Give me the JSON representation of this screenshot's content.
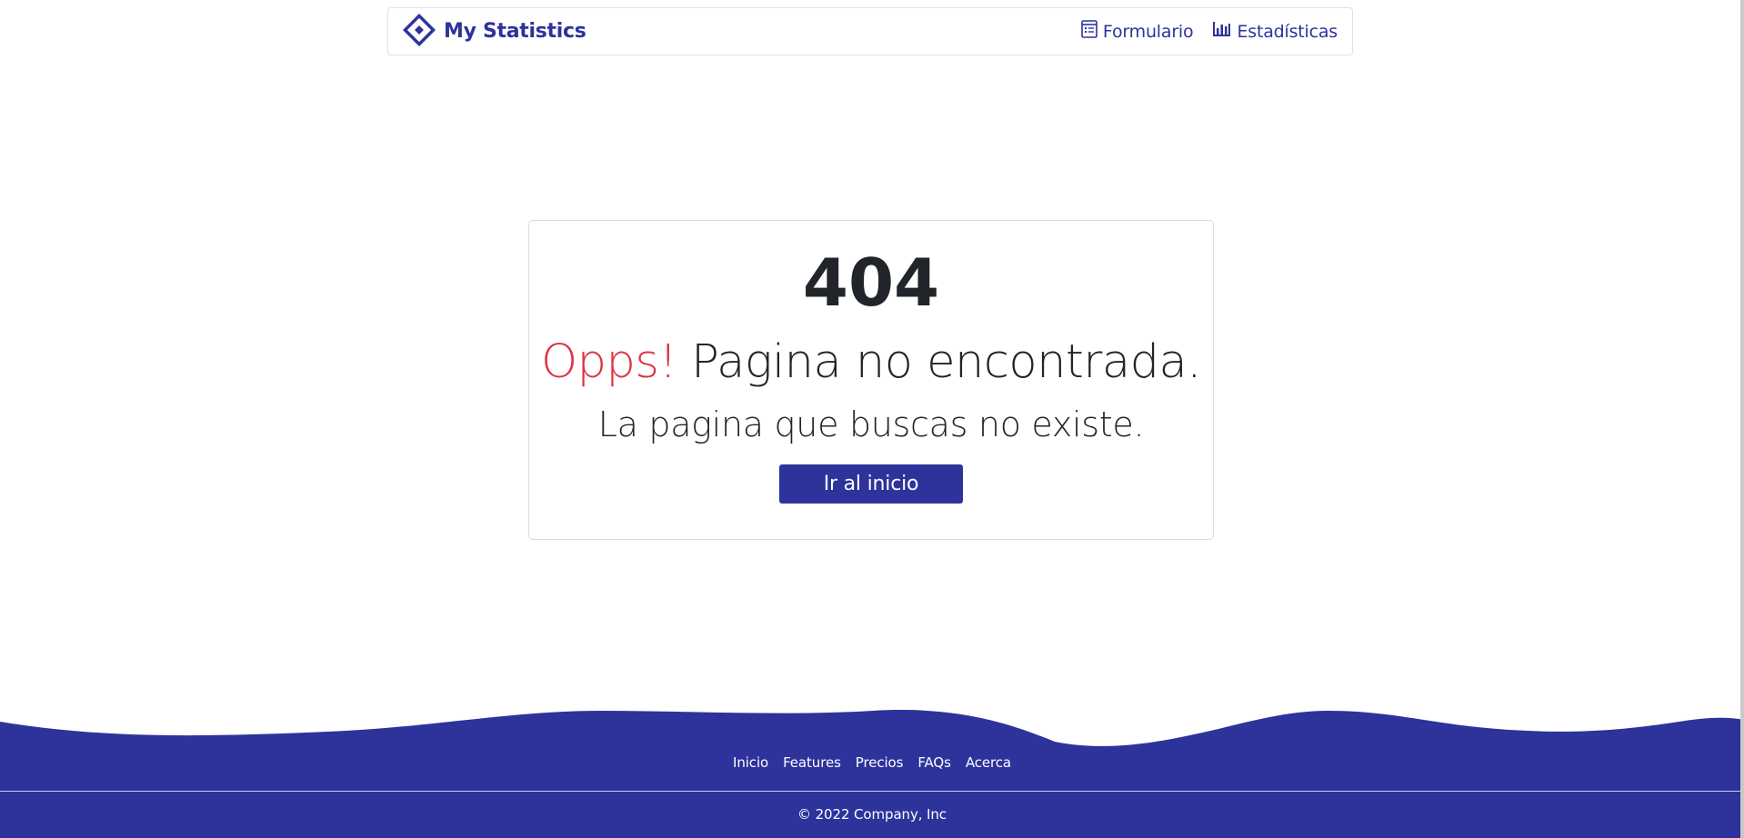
{
  "navbar": {
    "brand": "My Statistics",
    "links": [
      {
        "label": "Formulario",
        "icon": "form-icon"
      },
      {
        "label": "Estadísticas",
        "icon": "bar-chart-icon"
      }
    ]
  },
  "error": {
    "code": "404",
    "oops": "Opps!",
    "title": "Pagina no encontrada.",
    "message": "La pagina que buscas no existe.",
    "button_label": "Ir al inicio"
  },
  "footer": {
    "links": [
      "Inicio",
      "Features",
      "Precios",
      "FAQs",
      "Acerca"
    ],
    "copyright": "© 2022 Company, Inc"
  },
  "colors": {
    "primary": "#2d339b",
    "danger": "#dc3545",
    "text": "#212529"
  }
}
